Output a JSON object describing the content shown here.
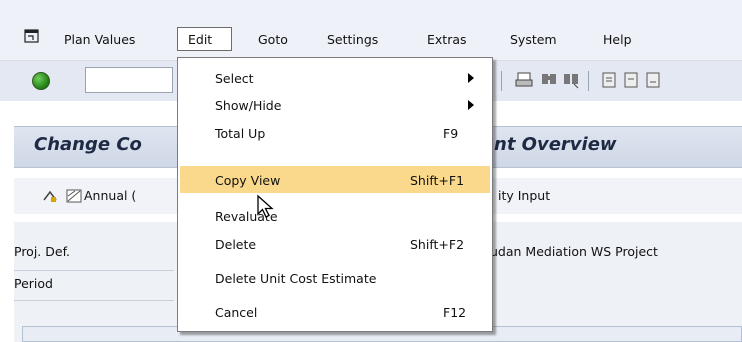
{
  "menubar": {
    "items": [
      {
        "label": "Plan Values"
      },
      {
        "label": "Edit"
      },
      {
        "label": "Goto"
      },
      {
        "label": "Settings"
      },
      {
        "label": "Extras"
      },
      {
        "label": "System"
      },
      {
        "label": "Help"
      }
    ]
  },
  "toolbar": {
    "command_field_value": ""
  },
  "title": {
    "left_fragment": "Change Co",
    "right_fragment": "nt Overview"
  },
  "app_toolbar": {
    "annual_label": "Annual (",
    "activity_input": "ity Input"
  },
  "form": {
    "proj_def_label": "Proj. Def.",
    "period_label": "Period",
    "project_value_fragment": "udan Mediation WS Project"
  },
  "edit_menu": {
    "items": [
      {
        "label": "Select",
        "shortcut": "",
        "submenu": true
      },
      {
        "label": "Show/Hide",
        "shortcut": "",
        "submenu": true
      },
      {
        "label": "Total Up",
        "shortcut": "F9",
        "submenu": false
      },
      {
        "label": "Copy View",
        "shortcut": "Shift+F1",
        "submenu": false,
        "highlighted": true
      },
      {
        "label": "Revaluate",
        "shortcut": "",
        "submenu": false
      },
      {
        "label": "Delete",
        "shortcut": "Shift+F2",
        "submenu": false
      },
      {
        "label": "Delete Unit Cost Estimate",
        "shortcut": "",
        "submenu": false
      },
      {
        "label": "Cancel",
        "shortcut": "F12",
        "submenu": false
      }
    ]
  },
  "colors": {
    "highlight": "#fbd98c",
    "title_text": "#1e2a44",
    "menubar_bg": "#eef1f8"
  }
}
